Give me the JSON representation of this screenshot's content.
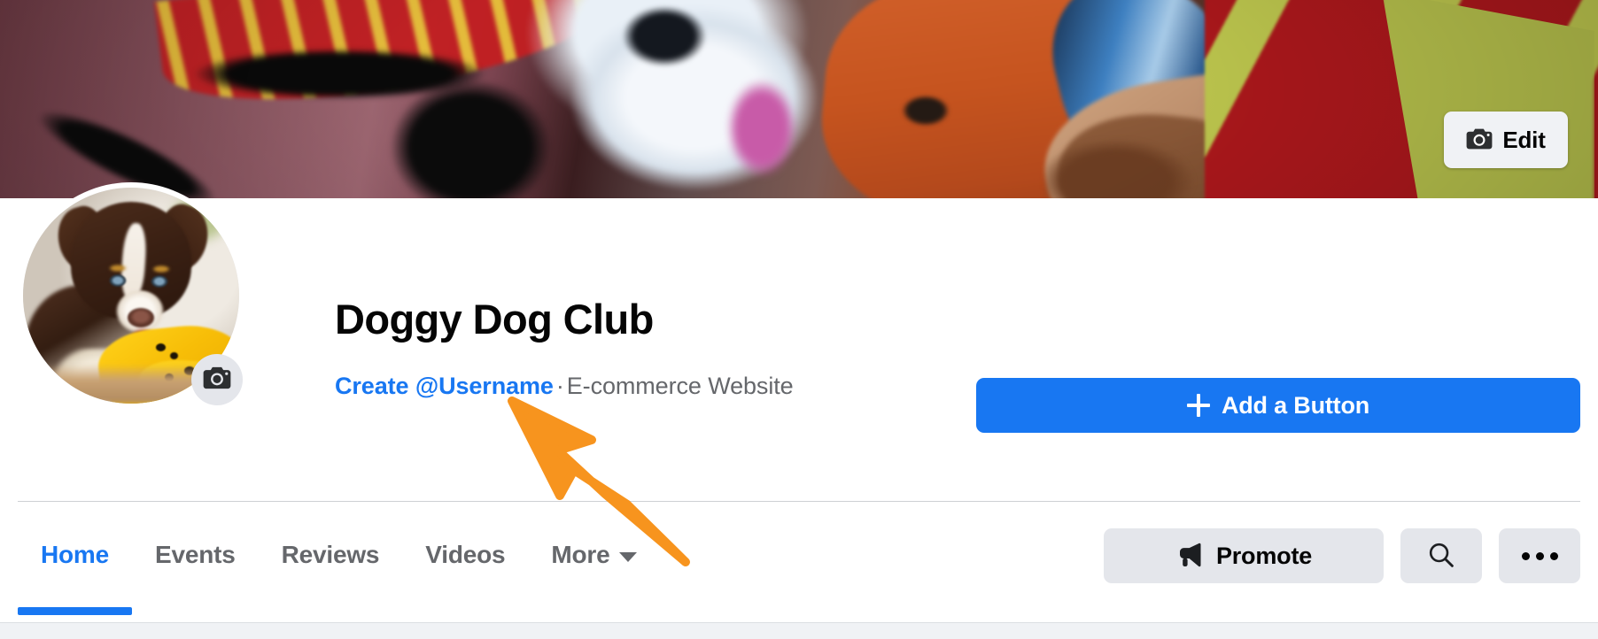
{
  "cover": {
    "edit_button": {
      "label": "Edit",
      "icon": "camera-icon"
    }
  },
  "profile": {
    "photo_alt": "puppy-profile-photo",
    "camera_badge_icon": "camera-icon",
    "title": "Doggy Dog Club",
    "subtitle": {
      "username_link": "Create @Username",
      "separator": "·",
      "category": "E-commerce Website"
    }
  },
  "cta": {
    "add_button_label": "Add a Button",
    "add_button_icon": "plus-icon",
    "color": "#1877f2"
  },
  "nav": {
    "tabs": [
      {
        "label": "Home",
        "active": true,
        "caret": false
      },
      {
        "label": "Events",
        "active": false,
        "caret": false
      },
      {
        "label": "Reviews",
        "active": false,
        "caret": false
      },
      {
        "label": "Videos",
        "active": false,
        "caret": false
      },
      {
        "label": "More",
        "active": false,
        "caret": true
      }
    ],
    "actions": {
      "promote_label": "Promote",
      "promote_icon": "megaphone-icon",
      "search_icon": "search-icon",
      "more_icon": "ellipsis-icon"
    }
  },
  "colors": {
    "accent_blue": "#1877f2",
    "text_primary": "#050505",
    "text_secondary": "#65676b",
    "button_grey": "#e4e6eb",
    "divider": "#ced0d4",
    "annotation_orange": "#f7941e"
  }
}
